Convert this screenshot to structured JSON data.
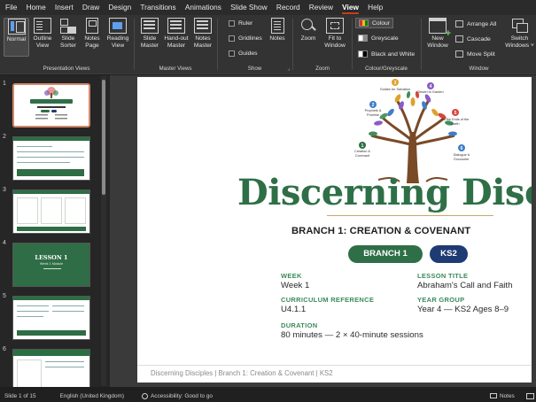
{
  "menu": [
    "File",
    "Home",
    "Insert",
    "Draw",
    "Design",
    "Transitions",
    "Animations",
    "Slide Show",
    "Record",
    "Review",
    "View",
    "Help"
  ],
  "menu_active_index": 10,
  "ribbon": {
    "presentation_views": {
      "label": "Presentation Views",
      "buttons": [
        {
          "l1": "Normal",
          "l2": ""
        },
        {
          "l1": "Outline",
          "l2": "View"
        },
        {
          "l1": "Slide",
          "l2": "Sorter"
        },
        {
          "l1": "Notes",
          "l2": "Page"
        },
        {
          "l1": "Reading",
          "l2": "View"
        }
      ]
    },
    "master_views": {
      "label": "Master Views",
      "buttons": [
        {
          "l1": "Slide",
          "l2": "Master"
        },
        {
          "l1": "Hand-out",
          "l2": "Master"
        },
        {
          "l1": "Notes",
          "l2": "Master"
        }
      ]
    },
    "show": {
      "label": "Show",
      "checks": [
        "Ruler",
        "Gridlines",
        "Guides"
      ],
      "notes": "Notes"
    },
    "zoom": {
      "label": "Zoom",
      "zoom": "Zoom",
      "fit_l1": "Fit to",
      "fit_l2": "Window"
    },
    "colour": {
      "label": "Colour/Greyscale",
      "options": [
        "Colour",
        "Greyscale",
        "Black and White"
      ]
    },
    "window": {
      "label": "Window",
      "new_l1": "New",
      "new_l2": "Window",
      "small": [
        "Arrange All",
        "Cascade",
        "Move Split"
      ],
      "switch_l1": "Switch",
      "switch_l2": "Windows ˅"
    }
  },
  "thumbnails": [
    "1",
    "2",
    "3",
    "4",
    "5",
    "6"
  ],
  "thumb4_text": {
    "a": "LESSON 1",
    "b": "Week 1 Module"
  },
  "slide": {
    "tree_labels": [
      {
        "n": "1",
        "t": "Creation & Covenant"
      },
      {
        "n": "2",
        "t": "Prophets & Promise"
      },
      {
        "n": "3",
        "t": "Guides for Salvation"
      },
      {
        "n": "4",
        "t": "Desert to Garden"
      },
      {
        "n": "5",
        "t": "To the Ends of the Earth"
      },
      {
        "n": "6",
        "t": "Dialogue & Encounter"
      }
    ],
    "title": "Discerning Discip",
    "subtitle": "BRANCH 1: CREATION & COVENANT",
    "pill_branch": "BRANCH 1",
    "pill_ks": "KS2",
    "fields": {
      "week_label": "WEEK",
      "week_value": "Week 1",
      "lesson_label": "LESSON TITLE",
      "lesson_value": "Abraham's Call and Faith",
      "curr_label": "CURRICULUM REFERENCE",
      "curr_value": "U4.1.1",
      "year_label": "YEAR GROUP",
      "year_value": "Year 4 — KS2 Ages 8–9",
      "duration_label": "DURATION",
      "duration_value": "80 minutes — 2 × 40-minute sessions"
    },
    "footer": "Discerning Disciples | Branch 1: Creation & Covenant | KS2"
  },
  "status": {
    "slide": "Slide 1 of 15",
    "language": "English (United Kingdom)",
    "accessibility": "Accessibility: Good to go",
    "notes": "Notes"
  },
  "colors": {
    "accent": "#c43e1c",
    "green": "#2f6f47",
    "navy": "#1f3b73"
  }
}
